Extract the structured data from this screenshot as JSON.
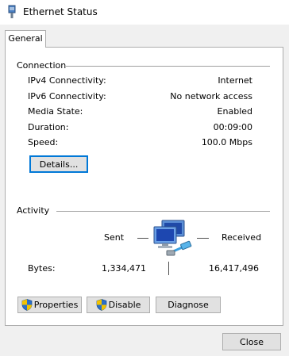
{
  "window": {
    "title": "Ethernet Status",
    "icon": "network-adapter-icon"
  },
  "tabs": [
    {
      "label": "General",
      "selected": true
    }
  ],
  "connection": {
    "title": "Connection",
    "rows": [
      {
        "label": "IPv4 Connectivity:",
        "value": "Internet"
      },
      {
        "label": "IPv6 Connectivity:",
        "value": "No network access"
      },
      {
        "label": "Media State:",
        "value": "Enabled"
      },
      {
        "label": "Duration:",
        "value": "00:09:00"
      },
      {
        "label": "Speed:",
        "value": "100.0 Mbps"
      }
    ],
    "details_button": "Details..."
  },
  "activity": {
    "title": "Activity",
    "sent_label": "Sent",
    "received_label": "Received",
    "bytes_label": "Bytes:",
    "bytes_sent": "1,334,471",
    "bytes_received": "16,417,496",
    "icon": "network-computer-icon"
  },
  "buttons": {
    "properties": "Properties",
    "disable": "Disable",
    "diagnose": "Diagnose",
    "close": "Close"
  },
  "colors": {
    "focus_border": "#0078d7",
    "shield_blue": "#2a6fc9",
    "shield_yellow": "#f2c200"
  }
}
